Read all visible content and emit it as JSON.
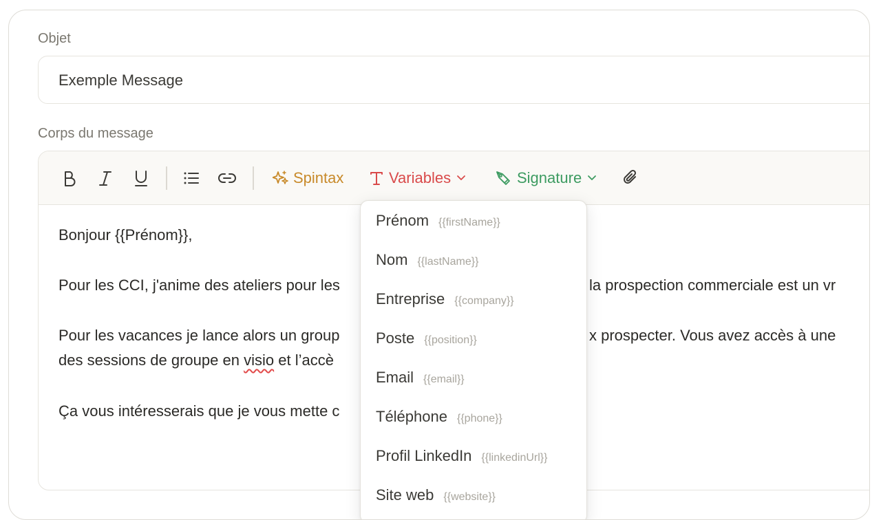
{
  "subject": {
    "label": "Objet",
    "value": "Exemple Message"
  },
  "body": {
    "label": "Corps du message",
    "paragraphs": [
      "Bonjour {{Prénom}},",
      "Pour les CCI, j'anime des ateliers pour les",
      "la prospection commerciale est un vr",
      "Pour les vacances je lance alors un group",
      "x prospecter. Vous avez accès à une",
      "des sessions de groupe en",
      "visio",
      "et l’accè",
      "Ça vous intéresserais que je vous mette c"
    ]
  },
  "toolbar": {
    "spintax_label": "Spintax",
    "variables_label": "Variables",
    "signature_label": "Signature"
  },
  "variables_menu": [
    {
      "label": "Prénom",
      "var": "{{firstName}}"
    },
    {
      "label": "Nom",
      "var": "{{lastName}}"
    },
    {
      "label": "Entreprise",
      "var": "{{company}}"
    },
    {
      "label": "Poste",
      "var": "{{position}}"
    },
    {
      "label": "Email",
      "var": "{{email}}"
    },
    {
      "label": "Téléphone",
      "var": "{{phone}}"
    },
    {
      "label": "Profil LinkedIn",
      "var": "{{linkedinUrl}}"
    },
    {
      "label": "Site web",
      "var": "{{website}}"
    }
  ],
  "colors": {
    "spintax": "#c88a2a",
    "variables": "#d94a4a",
    "signature": "#3d9b61"
  }
}
